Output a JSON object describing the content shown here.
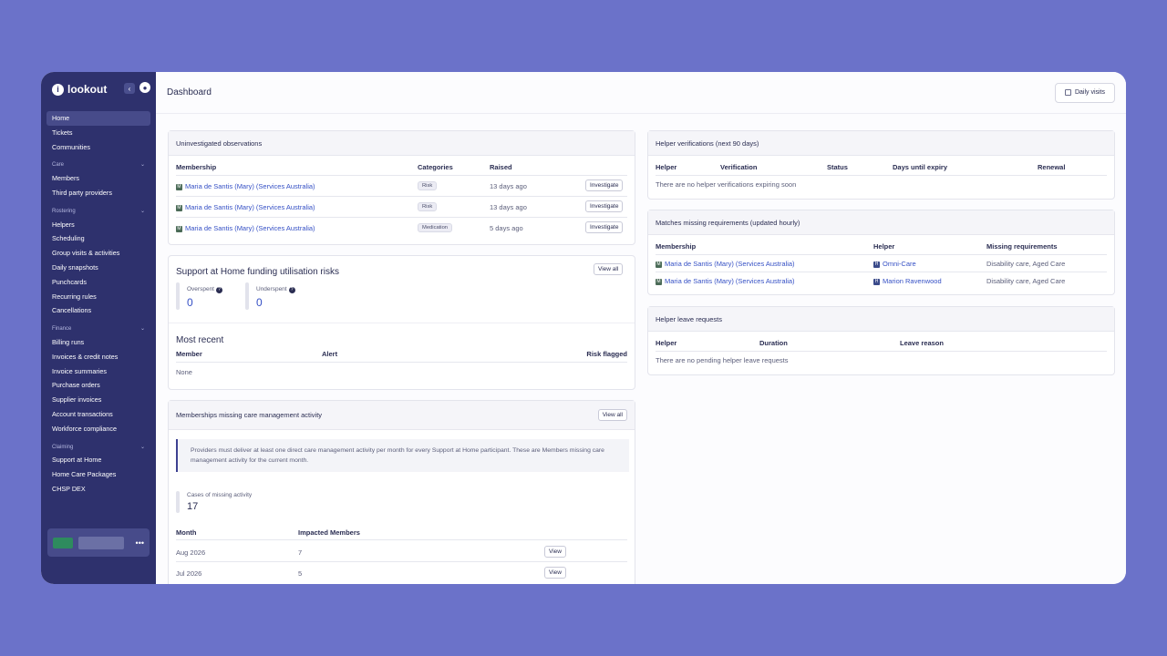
{
  "app": {
    "name": "lookout"
  },
  "sidebar": {
    "items": [
      {
        "type": "item",
        "label": "Home",
        "active": true
      },
      {
        "type": "item",
        "label": "Tickets"
      },
      {
        "type": "item",
        "label": "Communities"
      },
      {
        "type": "section",
        "label": "Care"
      },
      {
        "type": "item",
        "label": "Members"
      },
      {
        "type": "item",
        "label": "Third party providers"
      },
      {
        "type": "section",
        "label": "Rostering"
      },
      {
        "type": "item",
        "label": "Helpers"
      },
      {
        "type": "item",
        "label": "Scheduling"
      },
      {
        "type": "item",
        "label": "Group visits & activities"
      },
      {
        "type": "item",
        "label": "Daily snapshots"
      },
      {
        "type": "item",
        "label": "Punchcards"
      },
      {
        "type": "item",
        "label": "Recurring rules"
      },
      {
        "type": "item",
        "label": "Cancellations"
      },
      {
        "type": "section",
        "label": "Finance"
      },
      {
        "type": "item",
        "label": "Billing runs"
      },
      {
        "type": "item",
        "label": "Invoices & credit notes"
      },
      {
        "type": "item",
        "label": "Invoice summaries"
      },
      {
        "type": "item",
        "label": "Purchase orders"
      },
      {
        "type": "item",
        "label": "Supplier invoices"
      },
      {
        "type": "item",
        "label": "Account transactions"
      },
      {
        "type": "item",
        "label": "Workforce compliance"
      },
      {
        "type": "section",
        "label": "Claiming"
      },
      {
        "type": "item",
        "label": "Support at Home"
      },
      {
        "type": "item",
        "label": "Home Care Packages"
      },
      {
        "type": "item",
        "label": "CHSP DEX"
      }
    ]
  },
  "header": {
    "title": "Dashboard",
    "daily_visits": "Daily visits"
  },
  "uninvestigated": {
    "title": "Uninvestigated observations",
    "columns": [
      "Membership",
      "Categories",
      "Raised"
    ],
    "rows": [
      {
        "member": "Maria de Santis (Mary) (Services Australia)",
        "category": "Risk",
        "raised": "13 days ago",
        "action": "Investigate"
      },
      {
        "member": "Maria de Santis (Mary) (Services Australia)",
        "category": "Risk",
        "raised": "13 days ago",
        "action": "Investigate"
      },
      {
        "member": "Maria de Santis (Mary) (Services Australia)",
        "category": "Medication",
        "raised": "5 days ago",
        "action": "Investigate"
      }
    ]
  },
  "funding": {
    "title": "Support at Home funding utilisation risks",
    "view_all": "View all",
    "overspent_label": "Overspent",
    "overspent_value": "0",
    "underspent_label": "Underspent",
    "underspent_value": "0"
  },
  "recent": {
    "title": "Most recent",
    "columns": [
      "Member",
      "Alert",
      "Risk flagged"
    ],
    "empty": "None"
  },
  "missing_care": {
    "title": "Memberships missing care management activity",
    "view_all": "View all",
    "note": "Providers must deliver at least one direct care management activity per month for every Support at Home participant. These are Members missing care management activity for the current month.",
    "cases_label": "Cases of missing activity",
    "cases_value": "17",
    "columns": [
      "Month",
      "Impacted Members"
    ],
    "rows": [
      {
        "month": "Aug 2026",
        "count": "7",
        "action": "View"
      },
      {
        "month": "Jul 2026",
        "count": "5",
        "action": "View"
      }
    ]
  },
  "helper_verifications": {
    "title": "Helper verifications (next 90 days)",
    "columns": [
      "Helper",
      "Verification",
      "Status",
      "Days until expiry",
      "Renewal"
    ],
    "empty": "There are no helper verifications expiring soon"
  },
  "matches": {
    "title": "Matches missing requirements (updated hourly)",
    "columns": [
      "Membership",
      "Helper",
      "Missing requirements"
    ],
    "rows": [
      {
        "member": "Maria de Santis (Mary) (Services Australia)",
        "helper": "Omni-Care",
        "missing": "Disability care, Aged Care"
      },
      {
        "member": "Maria de Santis (Mary) (Services Australia)",
        "helper": "Marion Ravenwood",
        "missing": "Disability care, Aged Care"
      }
    ]
  },
  "leave": {
    "title": "Helper leave requests",
    "columns": [
      "Helper",
      "Duration",
      "Leave reason"
    ],
    "empty": "There are no pending helper leave requests"
  },
  "colors": {
    "sidebar": "#2e316d",
    "background": "#6b72c9",
    "link": "#3550c5"
  }
}
